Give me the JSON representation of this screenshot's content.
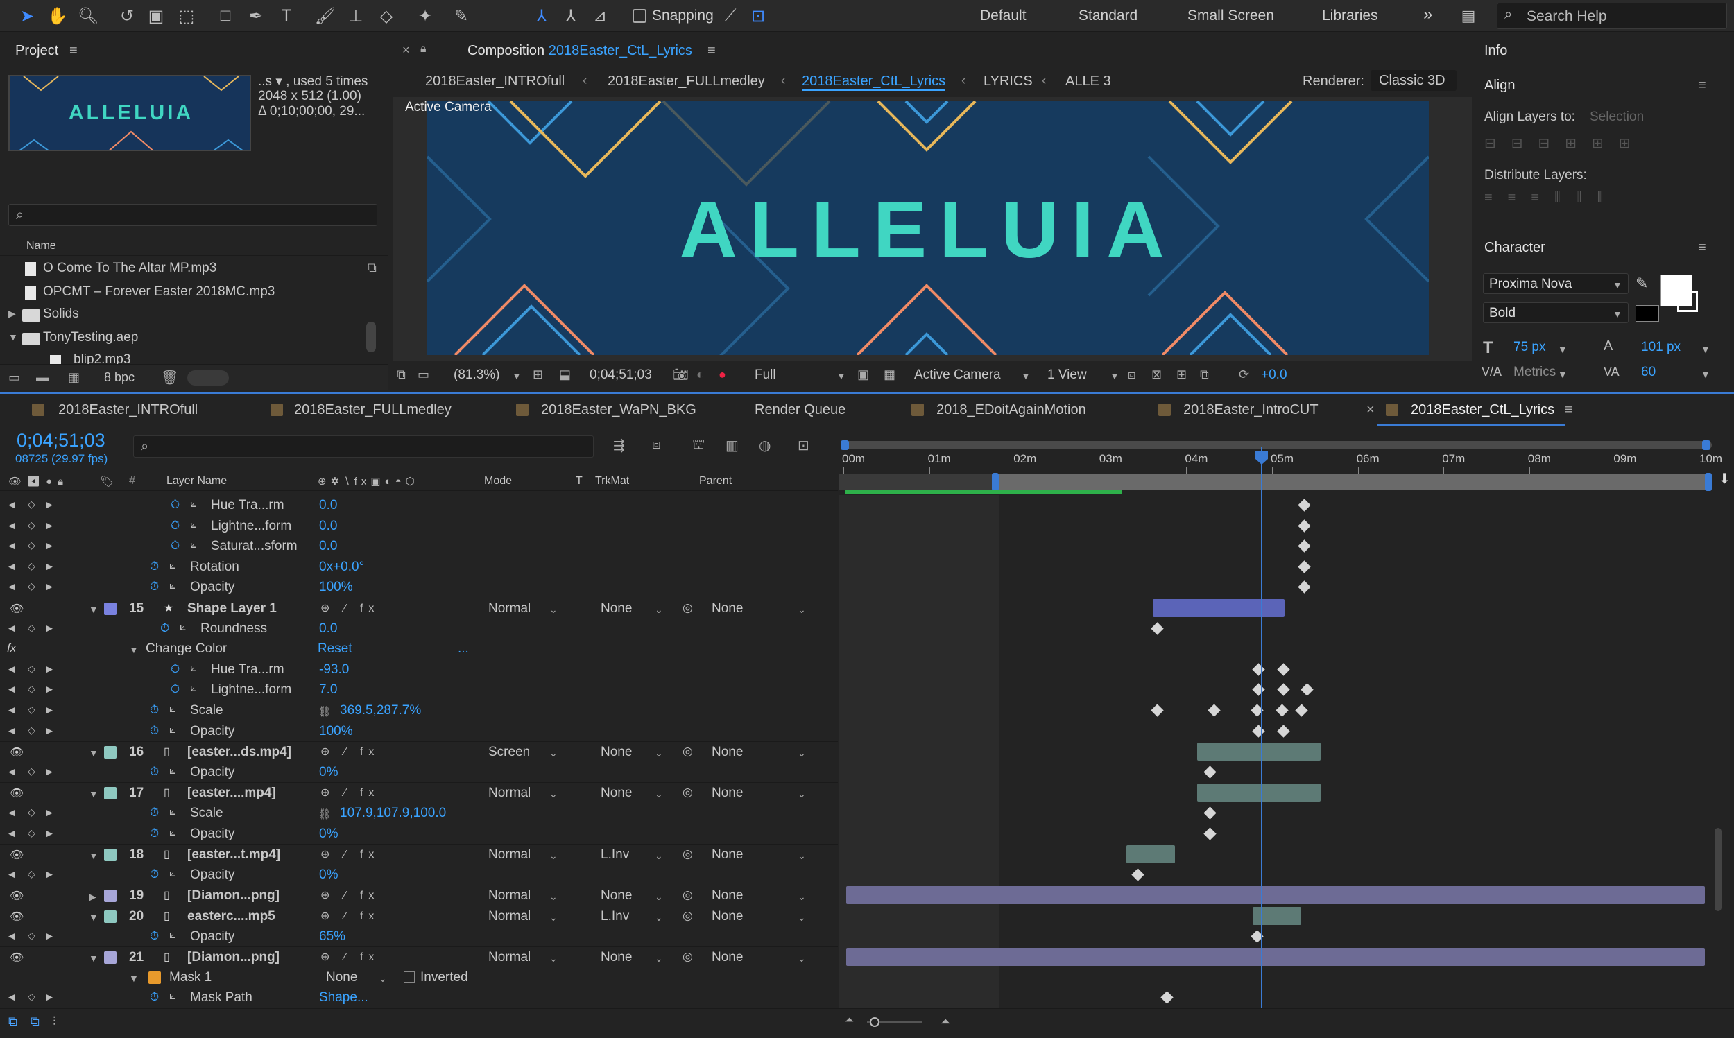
{
  "toolbar": {
    "snapping_label": "Snapping",
    "workspaces": [
      "Default",
      "Standard",
      "Small Screen",
      "Libraries"
    ],
    "more": "»",
    "search_placeholder": "Search Help"
  },
  "project": {
    "title": "Project",
    "thumb_text": "ALLELUIA",
    "info_line1": "..s ▾ , used 5 times",
    "info_line2": "2048 x 512 (1.00)",
    "info_line3": "Δ 0;10;00;00, 29...",
    "col_name": "Name",
    "items": [
      "O Come To The Altar MP.mp3",
      "OPCMT – Forever Easter 2018MC.mp3",
      "Solids",
      "TonyTesting.aep",
      "blip2.mp3"
    ],
    "bpc": "8 bpc"
  },
  "composition": {
    "label": "Composition",
    "name": "2018Easter_CtL_Lyrics",
    "breadcrumbs": [
      "2018Easter_INTROfull",
      "2018Easter_FULLmedley",
      "2018Easter_CtL_Lyrics",
      "LYRICS",
      "ALLE 3"
    ],
    "renderer_label": "Renderer:",
    "renderer_value": "Classic 3D",
    "active_camera": "Active Camera",
    "viewer_text": "ALLELUIA",
    "zoom": "(81.3%)",
    "timecode": "0;04;51;03",
    "resolution": "Full",
    "camera": "Active Camera",
    "views": "1 View",
    "exposure": "+0.0"
  },
  "right": {
    "info": "Info",
    "align": "Align",
    "align_layers_to": "Align Layers to:",
    "selection": "Selection",
    "distribute": "Distribute Layers:",
    "character": "Character",
    "font": "Proxima Nova",
    "style": "Bold",
    "size": "75 px",
    "leading": "101 px",
    "kerning": "Metrics",
    "tracking": "60"
  },
  "timeline": {
    "tabs": [
      "2018Easter_INTROfull",
      "2018Easter_FULLmedley",
      "2018Easter_WaPN_BKG",
      "Render Queue",
      "2018_EDoitAgainMotion",
      "2018Easter_IntroCUT",
      "2018Easter_CtL_Lyrics"
    ],
    "timecode": "0;04;51;03",
    "frames": "08725 (29.97 fps)",
    "headers": {
      "layer_name": "Layer Name",
      "mode": "Mode",
      "t": "T",
      "trkmat": "TrkMat",
      "parent": "Parent",
      "num": "#"
    },
    "ruler": [
      "00m",
      "01m",
      "02m",
      "03m",
      "04m",
      "05m",
      "06m",
      "07m",
      "08m",
      "09m",
      "10m"
    ],
    "rows": [
      {
        "name": "Hue Tra...rm",
        "value": "0.0"
      },
      {
        "name": "Lightne...form",
        "value": "0.0"
      },
      {
        "name": "Saturat...sform",
        "value": "0.0"
      },
      {
        "name": "Rotation",
        "value": "0x+0.0°"
      },
      {
        "name": "Opacity",
        "value": "100%"
      },
      {
        "num": "15",
        "name": "Shape Layer 1",
        "mode": "Normal",
        "trkmat": "None",
        "parent": "None"
      },
      {
        "name": "Roundness",
        "value": "0.0"
      },
      {
        "name": "Change Color",
        "value": "Reset",
        "extra": "..."
      },
      {
        "name": "Hue Tra...rm",
        "value": "-93.0"
      },
      {
        "name": "Lightne...form",
        "value": "7.0"
      },
      {
        "name": "Scale",
        "value": "369.5,287.7%"
      },
      {
        "name": "Opacity",
        "value": "100%"
      },
      {
        "num": "16",
        "name": "[easter...ds.mp4]",
        "mode": "Screen",
        "trkmat": "None",
        "parent": "None"
      },
      {
        "name": "Opacity",
        "value": "0%"
      },
      {
        "num": "17",
        "name": "[easter....mp4]",
        "mode": "Normal",
        "trkmat": "None",
        "parent": "None"
      },
      {
        "name": "Scale",
        "value": "107.9,107.9,100.0"
      },
      {
        "name": "Opacity",
        "value": "0%"
      },
      {
        "num": "18",
        "name": "[easter...t.mp4]",
        "mode": "Normal",
        "trkmat": "L.Inv",
        "parent": "None"
      },
      {
        "name": "Opacity",
        "value": "0%"
      },
      {
        "num": "19",
        "name": "[Diamon...png]",
        "mode": "Normal",
        "trkmat": "None",
        "parent": "None"
      },
      {
        "num": "20",
        "name": "easterc....mp5",
        "mode": "Normal",
        "trkmat": "L.Inv",
        "parent": "None"
      },
      {
        "name": "Opacity",
        "value": "65%"
      },
      {
        "num": "21",
        "name": "[Diamon...png]",
        "mode": "Normal",
        "trkmat": "None",
        "parent": "None"
      },
      {
        "name": "Mask 1",
        "mask_mode": "None",
        "inverted": "Inverted"
      },
      {
        "name": "Mask Path",
        "value": "Shape..."
      }
    ],
    "colors": {
      "label_blue": "#7a82e0",
      "label_teal": "#8ec8c0",
      "label_lilac": "#a7a6d8",
      "label_orange": "#e89a2c",
      "accent": "#3aa3ff"
    }
  }
}
